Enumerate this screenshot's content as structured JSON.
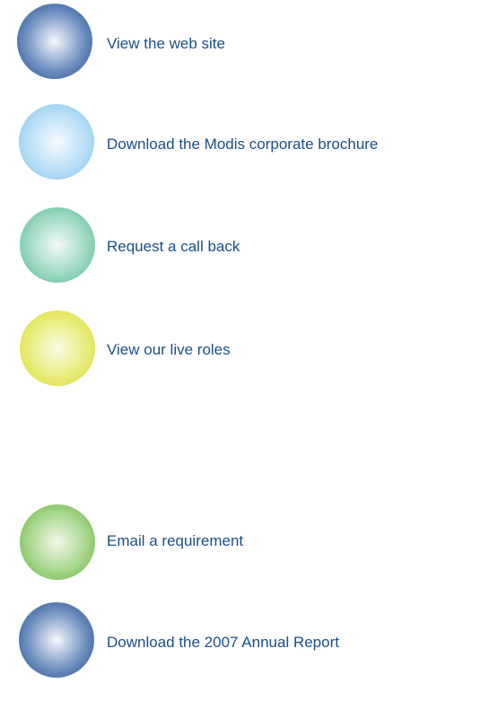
{
  "items": [
    {
      "label": "View the web site",
      "icon": "navy-sphere-icon",
      "color_light": "#f5f8fc",
      "color_mid": "#6f8fc0",
      "color_dark": "#1f4c8c"
    },
    {
      "label": "Download the Modis corporate brochure",
      "icon": "light-blue-sphere-icon",
      "color_light": "#f6fbfe",
      "color_mid": "#b8def6",
      "color_dark": "#7cc0ec"
    },
    {
      "label": "Request a call back",
      "icon": "teal-sphere-icon",
      "color_light": "#f4faf7",
      "color_mid": "#9dd9c2",
      "color_dark": "#52b793"
    },
    {
      "label": "View our live roles",
      "icon": "yellow-sphere-icon",
      "color_light": "#fafbe6",
      "color_mid": "#e9ec7a",
      "color_dark": "#d6da28"
    },
    {
      "label": "Email a requirement",
      "icon": "green-sphere-icon",
      "color_light": "#f2f8ec",
      "color_mid": "#a7d68a",
      "color_dark": "#5faf3c"
    },
    {
      "label": "Download the 2007 Annual Report",
      "icon": "navy-sphere-icon",
      "color_light": "#f5f8fc",
      "color_mid": "#6f8fc0",
      "color_dark": "#1f4c8c"
    }
  ]
}
